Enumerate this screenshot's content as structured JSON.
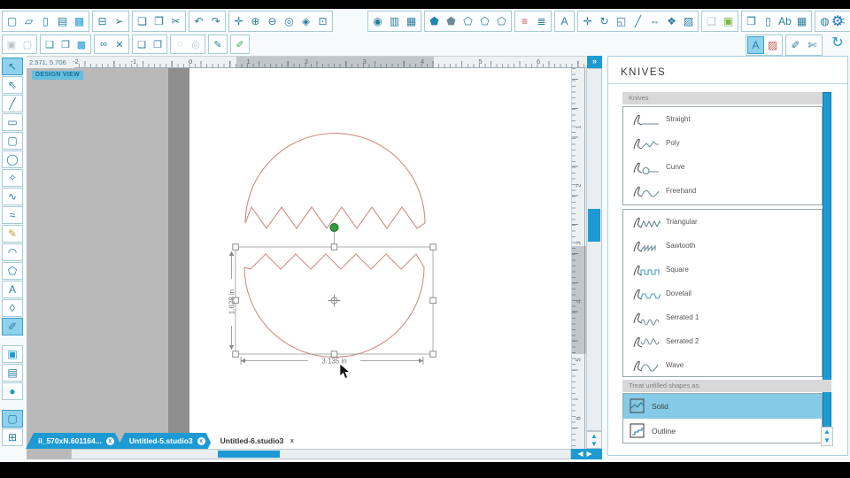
{
  "topbar": {
    "row1_groups": [
      {
        "items": [
          {
            "name": "new-document-icon",
            "glyph": "▢"
          },
          {
            "name": "open-icon",
            "glyph": "▱"
          },
          {
            "name": "save-to-library-icon",
            "glyph": "▯"
          },
          {
            "name": "save-icon",
            "glyph": "▤"
          },
          {
            "name": "save-as-icon",
            "glyph": "▩",
            "tint": "#2b9cd8"
          }
        ]
      },
      {
        "items": [
          {
            "name": "print-icon",
            "glyph": "⊟"
          },
          {
            "name": "send-to-machine-icon",
            "glyph": "➢"
          }
        ]
      },
      {
        "items": [
          {
            "name": "copy-icon",
            "glyph": "❏"
          },
          {
            "name": "paste-icon",
            "glyph": "❐"
          },
          {
            "name": "cut-icon",
            "glyph": "✂"
          }
        ]
      },
      {
        "items": [
          {
            "name": "undo-icon",
            "glyph": "↶"
          },
          {
            "name": "redo-icon",
            "glyph": "↷"
          }
        ]
      },
      {
        "items": [
          {
            "name": "pan-icon",
            "glyph": "✛"
          },
          {
            "name": "zoom-in-icon",
            "glyph": "⊕"
          },
          {
            "name": "zoom-out-icon",
            "glyph": "⊖"
          },
          {
            "name": "zoom-selection-icon",
            "glyph": "◎"
          },
          {
            "name": "zoom-drag-icon",
            "glyph": "◈"
          },
          {
            "name": "fit-to-page-icon",
            "glyph": "⊡"
          }
        ]
      },
      {
        "gapBefore": true,
        "items": [
          {
            "name": "trace-icon",
            "glyph": "◉"
          },
          {
            "name": "page-settings-icon",
            "glyph": "▥"
          },
          {
            "name": "registration-marks-icon",
            "glyph": "▦"
          }
        ]
      },
      {
        "items": [
          {
            "name": "fill-color-icon",
            "glyph": "⬟",
            "tint": "#1d86b5"
          },
          {
            "name": "fill-pattern-icon",
            "glyph": "⬟",
            "tint": "#6a8b97"
          },
          {
            "name": "fill-gradient-icon",
            "glyph": "⬠"
          },
          {
            "name": "line-color-icon",
            "glyph": "⬠"
          },
          {
            "name": "sketch-icon",
            "glyph": "⬠"
          }
        ]
      },
      {
        "items": [
          {
            "name": "line-color-bars-icon",
            "glyph": "≡",
            "tint": "#c0504d"
          },
          {
            "name": "line-style-icon",
            "glyph": "≣"
          }
        ]
      },
      {
        "items": [
          {
            "name": "text-style-icon",
            "glyph": "A"
          }
        ]
      },
      {
        "items": [
          {
            "name": "move-icon",
            "glyph": "✛"
          },
          {
            "name": "rotate-icon",
            "glyph": "↻"
          },
          {
            "name": "scale-icon",
            "glyph": "◱"
          },
          {
            "name": "shear-icon",
            "glyph": "╱"
          },
          {
            "name": "mirror-icon",
            "glyph": "⇔"
          },
          {
            "name": "effects-icon",
            "glyph": "❖"
          },
          {
            "name": "trace-area-icon",
            "glyph": "▨"
          }
        ]
      },
      {
        "items": [
          {
            "name": "stamp-icon",
            "glyph": "❑",
            "disabled": true
          },
          {
            "name": "modify-icon",
            "glyph": "▣",
            "tint": "#7ab648"
          }
        ]
      },
      {
        "items": [
          {
            "name": "page-curl-icon",
            "glyph": "❒"
          },
          {
            "name": "page-outline-icon",
            "glyph": "▯"
          },
          {
            "name": "text-ab-icon",
            "glyph": "Ab"
          },
          {
            "name": "table-icon",
            "glyph": "▦"
          }
        ]
      },
      {
        "items": [
          {
            "name": "rhinestone-icon",
            "glyph": "◍"
          },
          {
            "name": "dots-pattern-icon",
            "glyph": "∷"
          }
        ]
      }
    ],
    "row2_groups": [
      {
        "items": [
          {
            "name": "group-icon",
            "glyph": "▣",
            "disabled": true
          },
          {
            "name": "ungroup-icon",
            "glyph": "▢",
            "disabled": true
          }
        ]
      },
      {
        "items": [
          {
            "name": "bring-to-front-icon",
            "glyph": "❏"
          },
          {
            "name": "send-to-back-icon",
            "glyph": "❐"
          },
          {
            "name": "selection-box-icon",
            "glyph": "▩",
            "tint": "#1d9ad3"
          }
        ]
      },
      {
        "items": [
          {
            "name": "weld-icon",
            "glyph": "∞"
          },
          {
            "name": "delete-icon",
            "glyph": "✕"
          }
        ]
      },
      {
        "items": [
          {
            "name": "duplicate-left-icon",
            "glyph": "❏"
          },
          {
            "name": "duplicate-right-icon",
            "glyph": "❐"
          }
        ]
      },
      {
        "items": [
          {
            "name": "modify-panel-icon",
            "glyph": "◌",
            "disabled": true
          },
          {
            "name": "spiral-icon",
            "glyph": "◎",
            "disabled": true
          }
        ]
      },
      {
        "items": [
          {
            "name": "pick-pen-icon",
            "glyph": "✎"
          }
        ]
      },
      {
        "items": [
          {
            "name": "object-eraser-icon",
            "glyph": "✐",
            "tint": "#4a9e4a"
          }
        ]
      }
    ],
    "row2_right_groups": [
      {
        "items": [
          {
            "name": "text-panel-icon",
            "glyph": "A",
            "active": true
          },
          {
            "name": "fill-panel-icon",
            "glyph": "▨",
            "tint": "#c9605a"
          }
        ]
      },
      {
        "items": [
          {
            "name": "sketch-pen-icon",
            "glyph": "✐"
          },
          {
            "name": "cutter-panel-icon",
            "glyph": "✄"
          }
        ]
      }
    ],
    "settings_icon": {
      "name": "settings-icon",
      "glyph": "⚙",
      "tint": "#1b75bc"
    },
    "refresh_icon": {
      "name": "refresh-icon",
      "glyph": "↻",
      "tint": "#1d9ad3"
    }
  },
  "leftbar": {
    "items": [
      {
        "name": "select-tool",
        "glyph": "↖",
        "active": true
      },
      {
        "name": "edit-points-tool",
        "glyph": "⇖"
      },
      {
        "name": "line-tool",
        "glyph": "╱"
      },
      {
        "name": "rectangle-tool",
        "glyph": "▭"
      },
      {
        "name": "rounded-rectangle-tool",
        "glyph": "▢"
      },
      {
        "name": "ellipse-tool",
        "glyph": "◯"
      },
      {
        "name": "polygon-tool",
        "glyph": "✧"
      },
      {
        "name": "curve-tool",
        "glyph": "∿"
      },
      {
        "name": "freehand-tool",
        "glyph": "≈"
      },
      {
        "name": "smooth-freehand-tool",
        "glyph": "✎",
        "tint": "#c8a227"
      },
      {
        "name": "arc-tool",
        "glyph": "◠"
      },
      {
        "name": "regular-polygon-tool",
        "glyph": "⬠"
      },
      {
        "name": "text-tool",
        "glyph": "A"
      },
      {
        "name": "eraser-tool",
        "glyph": "◊"
      },
      {
        "name": "knife-tool",
        "glyph": "✐",
        "active": true
      },
      {
        "gap": true
      },
      {
        "name": "library-icon",
        "glyph": "▣",
        "tint": "#1d9ad3"
      },
      {
        "name": "store-icon",
        "glyph": "▤"
      },
      {
        "name": "cloud-icon",
        "glyph": "●",
        "tint": "#1d9ad3"
      },
      {
        "gap": true
      },
      {
        "name": "design-view-icon",
        "glyph": "▢",
        "active": true
      },
      {
        "name": "split-view-icon",
        "glyph": "⊞"
      }
    ]
  },
  "canvas": {
    "coordinates": "2.571, 5.706",
    "view_label": "DESIGN VIEW",
    "expand_label": "»",
    "h_ruler_numbers": [
      "-2",
      "-1",
      "0",
      "1",
      "2",
      "3",
      "4",
      "5",
      "6"
    ],
    "v_ruler_numbers": [
      "1",
      "2",
      "3",
      "4",
      "5",
      "6"
    ],
    "selection": {
      "height_label": "1.628 in",
      "width_label": "3.135 in"
    }
  },
  "scrollbars": {
    "up": "▲",
    "down": "▼",
    "left": "◀",
    "right": "▶"
  },
  "tabs": [
    {
      "label": "il_570xN.601164...",
      "close_label": "x",
      "active": false
    },
    {
      "label": "Untitled-5.studio3",
      "close_label": "x",
      "active": false
    },
    {
      "label": "Untitled-6.studio3",
      "close_label": "x",
      "active": true
    }
  ],
  "panel": {
    "title": "KNIVES",
    "group_header": "Knives",
    "knives_basic": [
      {
        "name": "straight",
        "label": "Straight"
      },
      {
        "name": "poly",
        "label": "Poly"
      },
      {
        "name": "curve",
        "label": "Curve"
      },
      {
        "name": "freehand",
        "label": "Freehand"
      }
    ],
    "knives_patterned": [
      {
        "name": "triangular",
        "label": "Triangular"
      },
      {
        "name": "sawtooth",
        "label": "Sawtooth"
      },
      {
        "name": "square",
        "label": "Square"
      },
      {
        "name": "dovetail",
        "label": "Dovetail"
      },
      {
        "name": "serrated1",
        "label": "Serrated 1"
      },
      {
        "name": "serrated2",
        "label": "Serrated 2"
      },
      {
        "name": "wave",
        "label": "Wave"
      }
    ],
    "treat_header": "Treat unfilled shapes as.",
    "treat_options": [
      {
        "name": "solid",
        "label": "Solid",
        "selected": true
      },
      {
        "name": "outline",
        "label": "Outline",
        "selected": false
      }
    ]
  },
  "colors": {
    "accent": "#1d9ad3",
    "icon_teal": "#2a7d9e",
    "shape_stroke": "#cf8d84",
    "rotate_handle": "#2e9e3c",
    "workspace": "#b9b9b9"
  }
}
